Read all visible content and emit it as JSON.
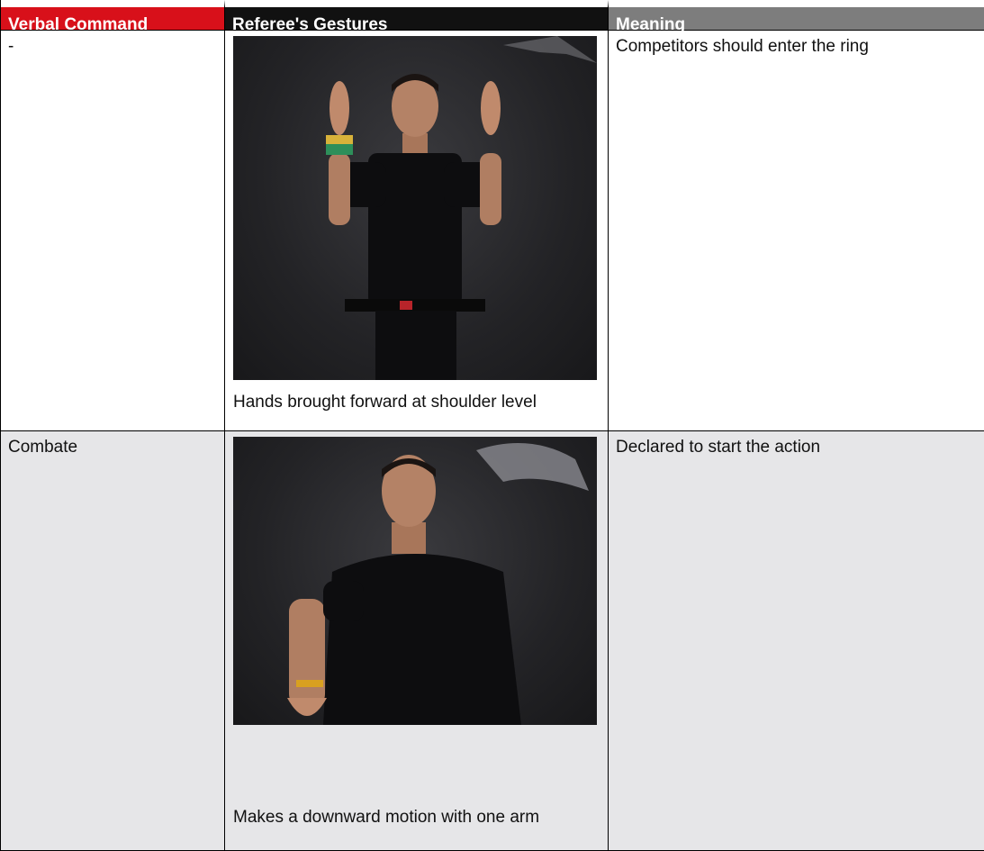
{
  "table": {
    "headers": [
      "Verbal Command",
      "Referee's Gestures",
      "Meaning"
    ],
    "rows": [
      {
        "command": "-",
        "gesture_caption": "Hands brought forward at shoulder level",
        "meaning": "Competitors should enter the ring",
        "photo": "referee-hands-raised-photo"
      },
      {
        "command": "Combate",
        "gesture_caption": "Makes a downward motion with one arm",
        "meaning": "Declared to start the action",
        "photo": "referee-arm-forward-photo"
      }
    ]
  },
  "colors": {
    "header_red": "#d8101a",
    "header_dark": "#111111",
    "header_grey": "#7d7d7d",
    "row_alt": "#e6e6e8"
  }
}
